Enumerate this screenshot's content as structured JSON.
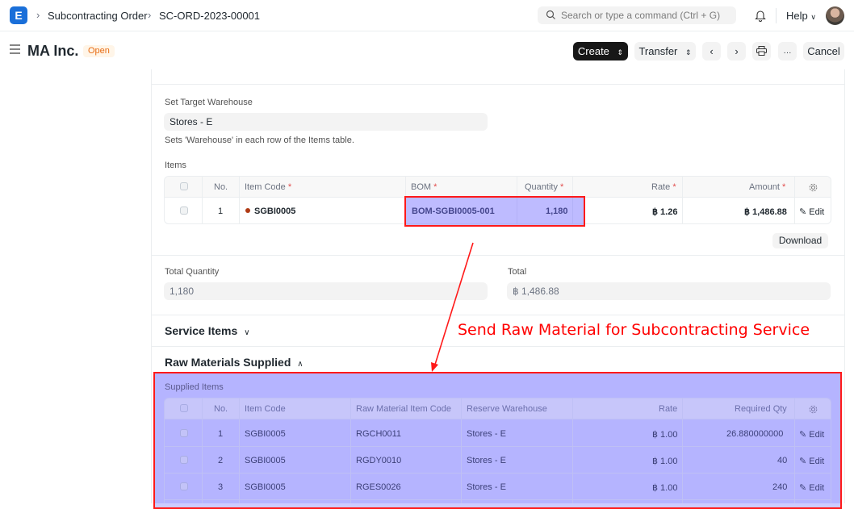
{
  "navbar": {
    "logo": "E",
    "breadcrumbs": [
      "Subcontracting Order",
      "SC-ORD-2023-00001"
    ],
    "search_placeholder": "Search or type a command (Ctrl + G)",
    "help_label": "Help"
  },
  "header": {
    "title": "MA Inc.",
    "status": "Open",
    "create_label": "Create",
    "transfer_label": "Transfer",
    "more_label": "···",
    "cancel_label": "Cancel"
  },
  "form": {
    "target_warehouse_label": "Set Target Warehouse",
    "target_warehouse_value": "Stores - E",
    "target_warehouse_hint": "Sets 'Warehouse' in each row of the Items table.",
    "items_label": "Items",
    "items_columns": [
      "No.",
      "Item Code",
      "BOM",
      "Quantity",
      "Rate",
      "Amount"
    ],
    "items_rows": [
      {
        "no": "1",
        "item_code": "SGBI0005",
        "bom": "BOM-SGBI0005-001",
        "quantity": "1,180",
        "rate": "฿ 1.26",
        "amount": "฿ 1,486.88",
        "edit": "Edit"
      }
    ],
    "download_label": "Download",
    "total_qty_label": "Total Quantity",
    "total_qty_value": "1,180",
    "total_label": "Total",
    "total_value": "฿ 1,486.88",
    "service_items_title": "Service Items",
    "raw_materials_title": "Raw Materials Supplied",
    "supplied_items_label": "Supplied Items",
    "supplied_columns": [
      "No.",
      "Item Code",
      "Raw Material Item Code",
      "Reserve Warehouse",
      "Rate",
      "Required Qty"
    ],
    "supplied_rows": [
      {
        "no": "1",
        "item_code": "SGBI0005",
        "rm_code": "RGCH0011",
        "warehouse": "Stores - E",
        "rate": "฿ 1.00",
        "qty": "26.880000000",
        "edit": "Edit"
      },
      {
        "no": "2",
        "item_code": "SGBI0005",
        "rm_code": "RGDY0010",
        "warehouse": "Stores - E",
        "rate": "฿ 1.00",
        "qty": "40",
        "edit": "Edit"
      },
      {
        "no": "3",
        "item_code": "SGBI0005",
        "rm_code": "RGES0026",
        "warehouse": "Stores - E",
        "rate": "฿ 1.00",
        "qty": "240",
        "edit": "Edit"
      }
    ]
  },
  "annotation": {
    "text": "Send Raw Material for Subcontracting Service",
    "color": "#ff0000"
  },
  "colors": {
    "brand": "#1a6fd9",
    "highlight_fill": "#6e69ff",
    "status_open": "#e86c13"
  }
}
